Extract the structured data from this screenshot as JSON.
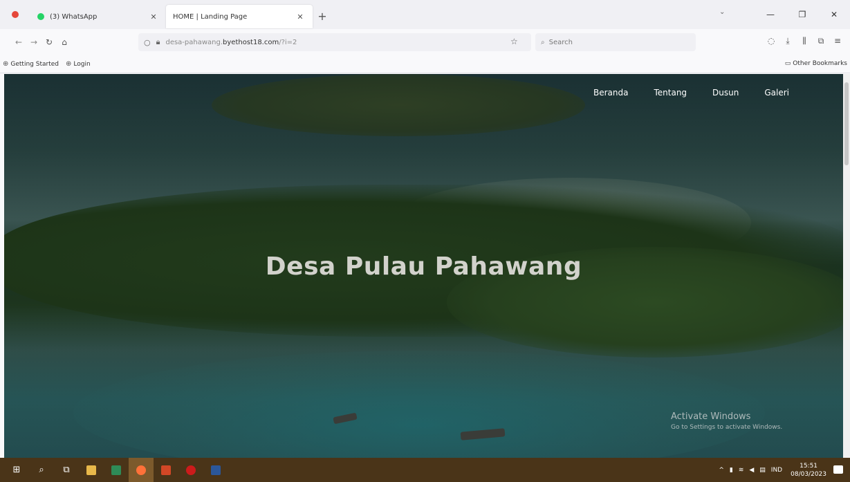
{
  "browser": {
    "tabs": [
      {
        "title": "(3) WhatsApp",
        "icon": "whatsapp-icon",
        "active": false
      },
      {
        "title": "HOME | Landing Page",
        "icon": "",
        "active": true
      }
    ],
    "new_tab_label": "+",
    "url_prefix": "desa-pahawang.",
    "url_domain": "byethost18.com",
    "url_suffix": "/?i=2",
    "search_placeholder": "Search",
    "bookmarks": [
      {
        "label": "Getting Started"
      },
      {
        "label": "Login"
      }
    ],
    "other_bookmarks": "Other Bookmarks"
  },
  "site": {
    "nav": [
      "Beranda",
      "Tentang",
      "Dusun",
      "Galeri"
    ],
    "hero_title": "Desa Pulau Pahawang"
  },
  "watermark": {
    "line1": "Activate Windows",
    "line2": "Go to Settings to activate Windows."
  },
  "taskbar": {
    "lang": "IND",
    "time": "15:51",
    "date": "08/03/2023"
  },
  "colors": {
    "taskbar_bg": "#4a3418",
    "hero_text": "#d2d2cc"
  }
}
